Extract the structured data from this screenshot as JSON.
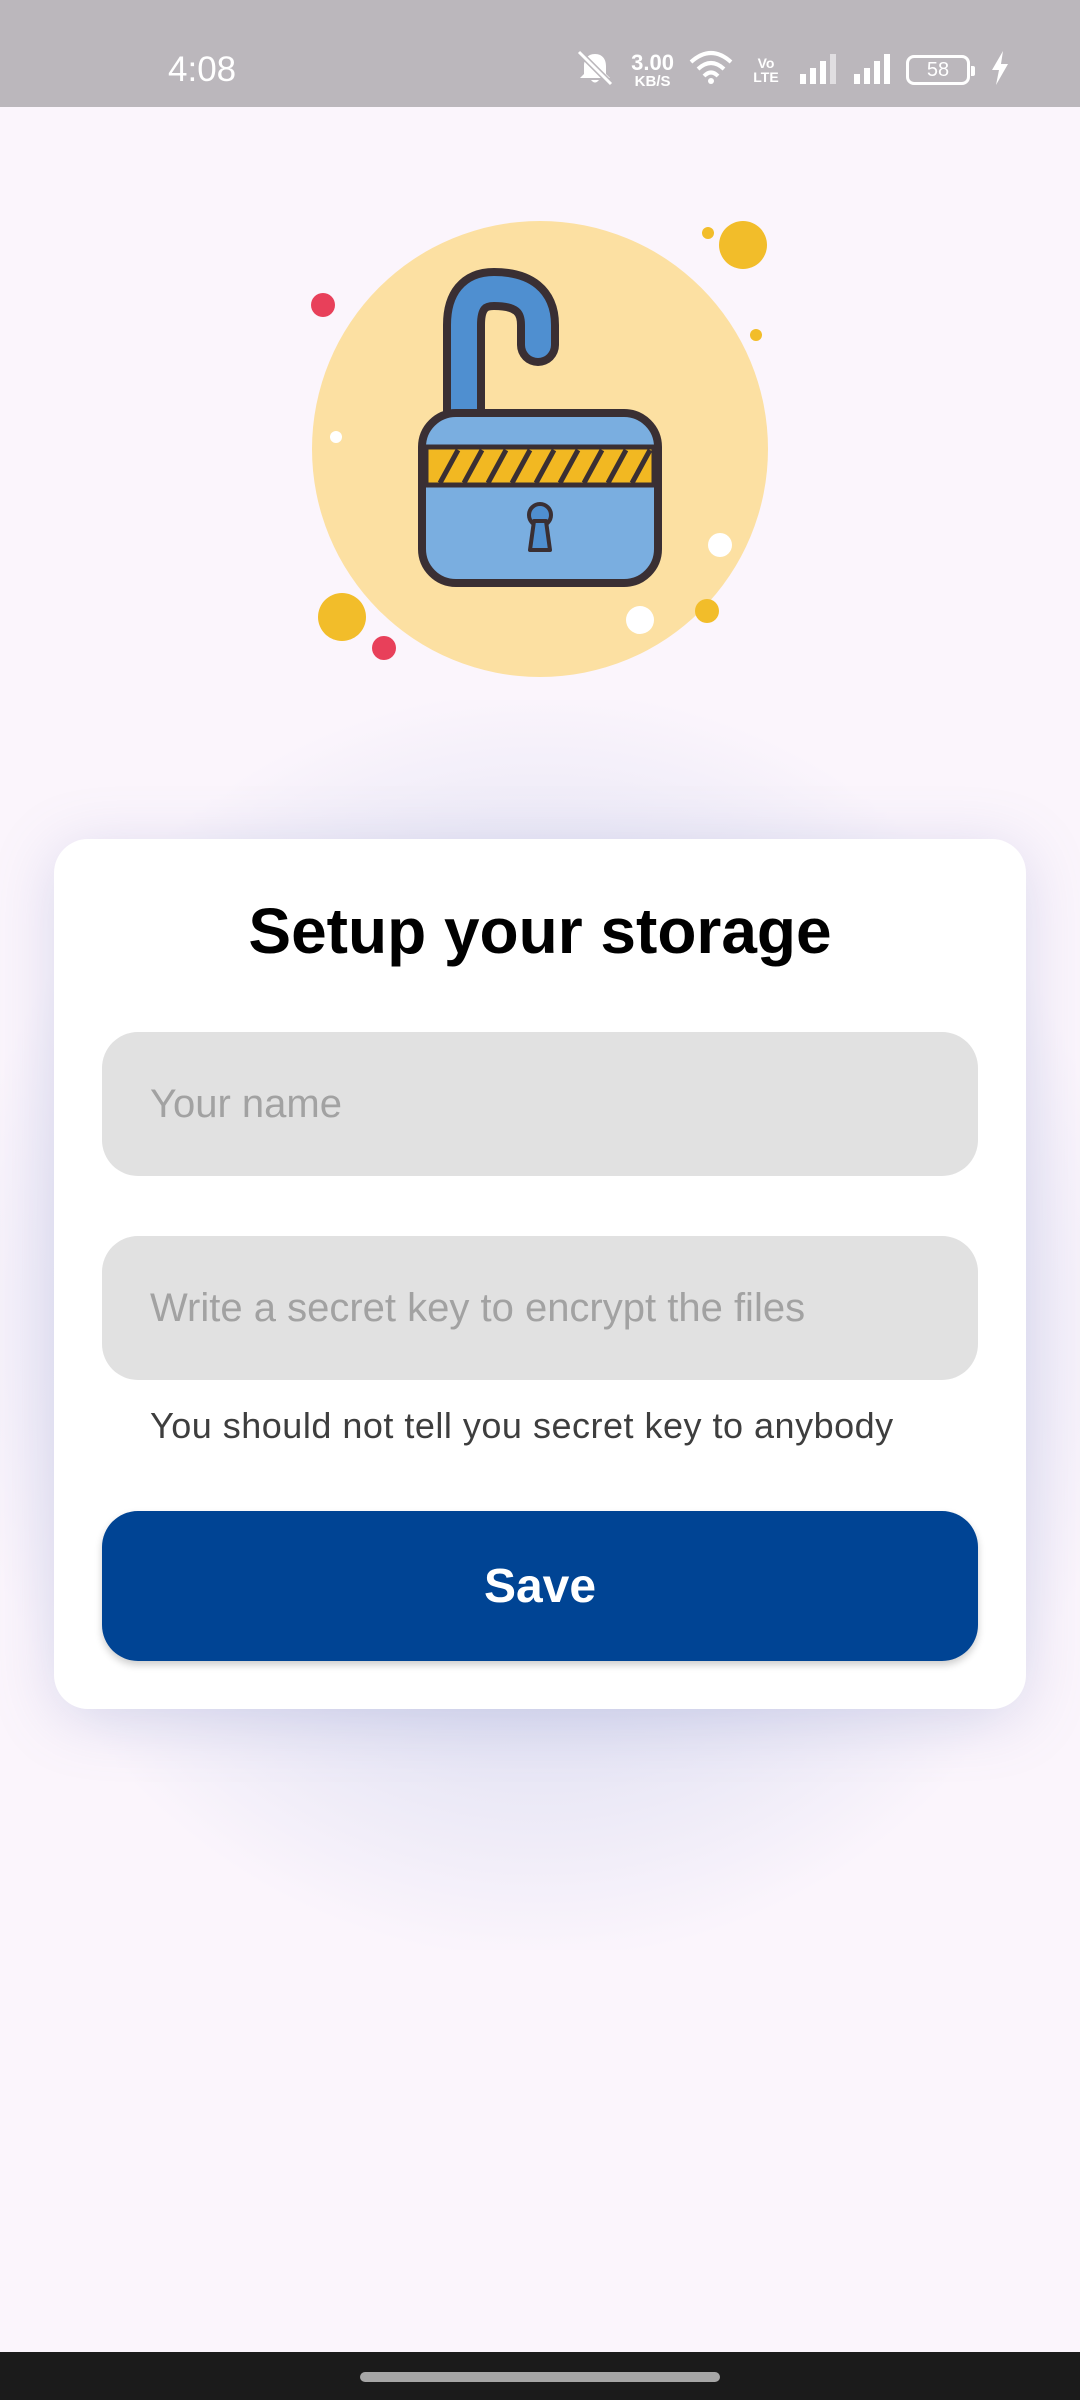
{
  "status_bar": {
    "time": "4:08",
    "net_speed_value": "3.00",
    "net_speed_unit": "KB/S",
    "volte_label": "Vo LTE",
    "battery_level": "58",
    "icons": [
      "mute-icon",
      "wifi-icon",
      "volte-icon",
      "signal-icon",
      "signal-icon",
      "battery-icon",
      "charging-icon"
    ]
  },
  "illustration": {
    "icon": "unlocked-padlock-icon",
    "colors": {
      "circle": "#fce0a2",
      "lock_body": "#7aaee0",
      "shackle": "#4f8fd0",
      "stripe": "#f2b822",
      "outline": "#3a2f33",
      "dot_red": "#e8405a",
      "dot_yellow": "#f2bd2a"
    }
  },
  "form": {
    "title": "Setup your storage",
    "name_placeholder": "Your name",
    "name_value": "",
    "key_placeholder": "Write a secret key to encrypt the files",
    "key_value": "",
    "helper_text": "You should not tell you secret key to anybody",
    "save_label": "Save"
  },
  "colors": {
    "background": "#fbf5fc",
    "status_bar": "#bbb7bc",
    "card": "#ffffff",
    "field": "#e1e1e1",
    "primary_button": "#004494",
    "nav_bar": "#1b1b1b"
  }
}
